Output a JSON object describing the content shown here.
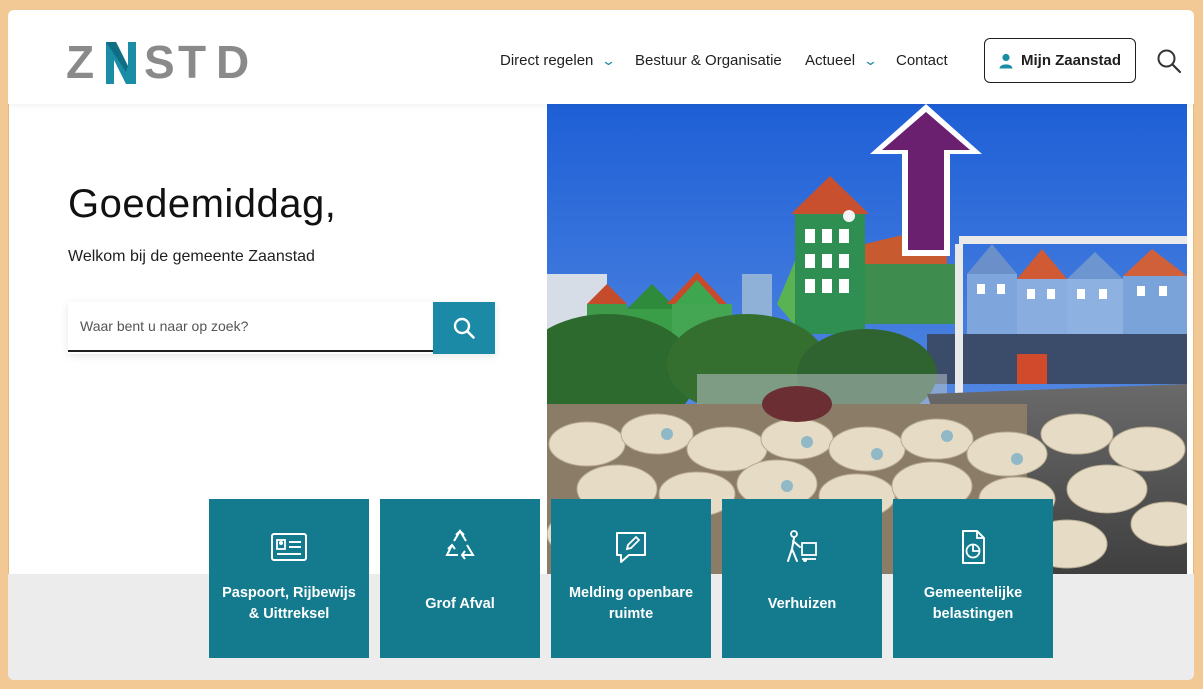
{
  "brand": {
    "logo_text": "ZNSTD",
    "logo_letters": [
      "Z",
      "N",
      "S",
      "T",
      "D"
    ],
    "logo_grey": "#8a8a8a",
    "logo_teal": "#1a8ca6"
  },
  "nav": {
    "items": [
      {
        "label": "Direct regelen",
        "has_dropdown": true
      },
      {
        "label": "Bestuur & Organisatie",
        "has_dropdown": false
      },
      {
        "label": "Actueel",
        "has_dropdown": true
      },
      {
        "label": "Contact",
        "has_dropdown": false
      }
    ],
    "chevron": "⌄",
    "login_label": "Mijn Zaanstad",
    "login_icon": "user-icon",
    "search_icon": "search-icon"
  },
  "hero": {
    "greeting": "Goedemiddag,",
    "welcome": "Welkom bij de gemeente Zaanstad",
    "search_placeholder": "Waar bent u naar op zoek?",
    "search_value": "",
    "image_subject": "sheep-herd-in-front-of-zaandam-buildings"
  },
  "tiles": [
    {
      "label": "Paspoort, Rijbewijs & Uittreksel",
      "icon": "id-card-icon"
    },
    {
      "label": "Grof Afval",
      "icon": "recycle-icon"
    },
    {
      "label": "Melding openbare ruimte",
      "icon": "report-bubble-icon"
    },
    {
      "label": "Verhuizen",
      "icon": "moving-icon"
    },
    {
      "label": "Gemeentelijke belastingen",
      "icon": "tax-document-icon"
    }
  ],
  "colors": {
    "accent": "#1a8aa6",
    "tile_bg": "#147b8f",
    "frame_border": "#f2c895",
    "annotation_arrow": "#6b1f6f"
  }
}
